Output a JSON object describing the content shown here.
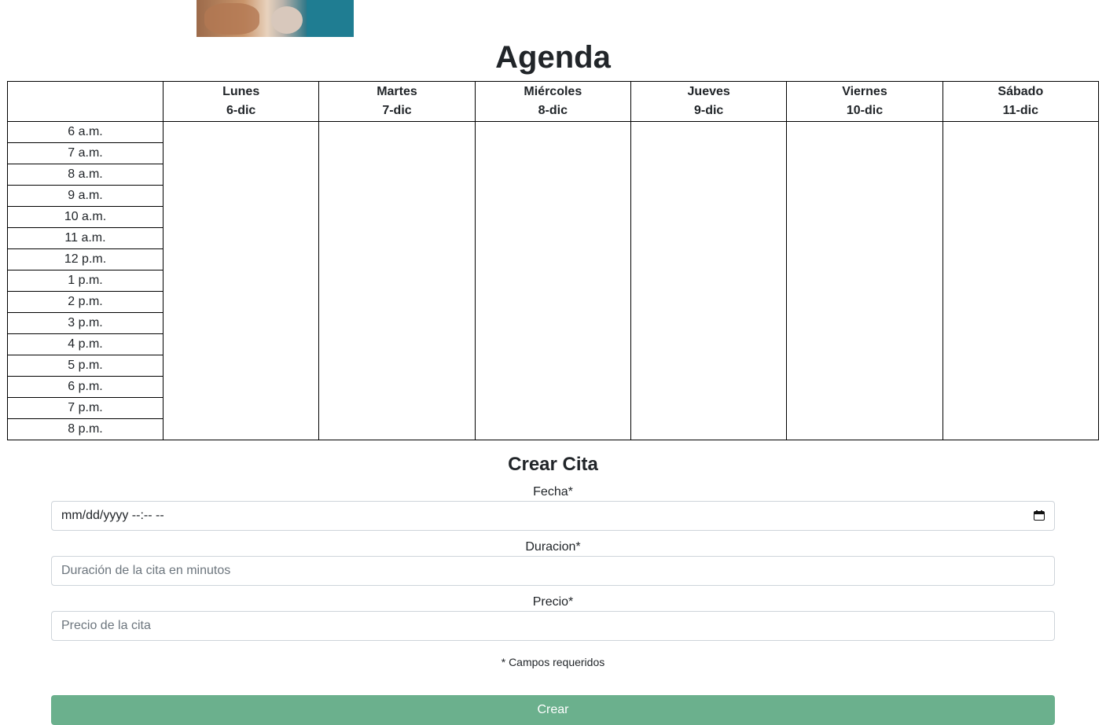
{
  "header": {
    "title": "Agenda"
  },
  "agenda": {
    "days": [
      {
        "name": "Lunes",
        "date": "6-dic"
      },
      {
        "name": "Martes",
        "date": "7-dic"
      },
      {
        "name": "Miércoles",
        "date": "8-dic"
      },
      {
        "name": "Jueves",
        "date": "9-dic"
      },
      {
        "name": "Viernes",
        "date": "10-dic"
      },
      {
        "name": "Sábado",
        "date": "11-dic"
      }
    ],
    "hours": [
      "6 a.m.",
      "7 a.m.",
      "8 a.m.",
      "9 a.m.",
      "10 a.m.",
      "11 a.m.",
      "12 p.m.",
      "1 p.m.",
      "2 p.m.",
      "3 p.m.",
      "4 p.m.",
      "5 p.m.",
      "6 p.m.",
      "7 p.m.",
      "8 p.m."
    ]
  },
  "form": {
    "title": "Crear Cita",
    "fecha_label": "Fecha*",
    "fecha_value": "mm/dd/yyyy --:-- --",
    "duracion_label": "Duracion*",
    "duracion_placeholder": "Duración de la cita en minutos",
    "precio_label": "Precio*",
    "precio_placeholder": "Precio de la cita",
    "required_note": "* Campos requeridos",
    "submit_label": "Crear"
  },
  "colors": {
    "submit_bg": "#6bb08d",
    "border": "#000000",
    "input_border": "#ced4da"
  },
  "icons": {
    "date_picker": "calendar-icon"
  }
}
